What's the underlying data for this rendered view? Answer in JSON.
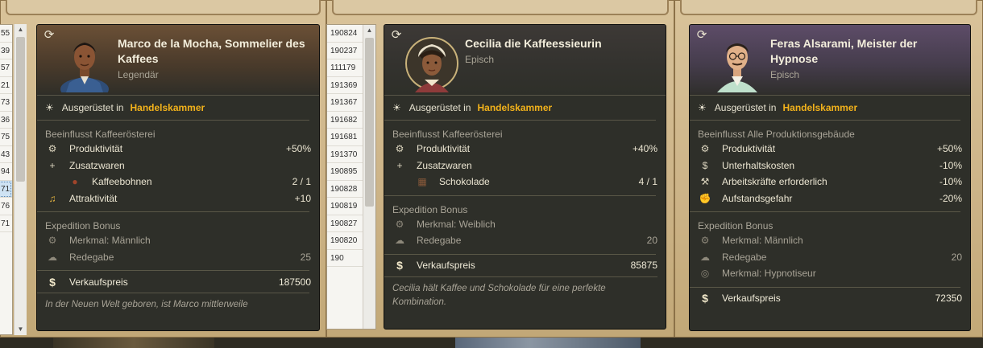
{
  "colors": {
    "accent": "#f2b21b",
    "card_bg": "#2e2f29",
    "list_bg": "#f6f5f1"
  },
  "left_list": {
    "ids": [
      "55",
      "39",
      "57",
      "21",
      "73",
      "36",
      "75",
      "43",
      "94",
      "71",
      "76",
      "71"
    ],
    "selected_index": 9
  },
  "middle_list": {
    "ids": [
      "190824",
      "190237",
      "111179",
      "191369",
      "191367",
      "191682",
      "191681",
      "191370",
      "190895",
      "190828",
      "190819",
      "190827",
      "190820",
      "190"
    ]
  },
  "cards": [
    {
      "portrait_icon": "portrait-marco",
      "title": "Marco de la Mocha, Sommelier des Kaffees",
      "rarity": "Legendär",
      "equip_label": "Ausgerüstet in",
      "equip_value": "Handelskammer",
      "influence_header": "Beeinflusst Kaffeerösterei",
      "stats": [
        {
          "icon": "gear-icon",
          "label": "Produktivität",
          "value": "+50%",
          "sub": false
        },
        {
          "icon": "plus-icon",
          "label": "Zusatzwaren",
          "value": "",
          "sub": false
        },
        {
          "icon": "coffee-beans-icon",
          "label": "Kaffeebohnen",
          "value": "2 / 1",
          "sub": true
        },
        {
          "icon": "lyre-icon",
          "label": "Attraktivität",
          "value": "+10",
          "sub": false
        }
      ],
      "expedition_header": "Expedition Bonus",
      "expedition": [
        {
          "icon": "trait-icon",
          "label": "Merkmal:  Männlich",
          "value": ""
        },
        {
          "icon": "speech-icon",
          "label": "Redegabe",
          "value": "25"
        }
      ],
      "price_label": "Verkaufspreis",
      "price_value": "187500",
      "flavor": "In der Neuen Welt geboren, ist Marco mittlerweile"
    },
    {
      "portrait_icon": "portrait-cecilia",
      "title": "Cecilia die Kaffeessieurin",
      "rarity": "Episch",
      "equip_label": "Ausgerüstet in",
      "equip_value": "Handelskammer",
      "influence_header": "Beeinflusst Kaffeerösterei",
      "stats": [
        {
          "icon": "gear-icon",
          "label": "Produktivität",
          "value": "+40%",
          "sub": false
        },
        {
          "icon": "plus-icon",
          "label": "Zusatzwaren",
          "value": "",
          "sub": false
        },
        {
          "icon": "chocolate-icon",
          "label": "Schokolade",
          "value": "4 / 1",
          "sub": true
        }
      ],
      "expedition_header": "Expedition Bonus",
      "expedition": [
        {
          "icon": "trait-icon",
          "label": "Merkmal:  Weiblich",
          "value": ""
        },
        {
          "icon": "speech-icon",
          "label": "Redegabe",
          "value": "20"
        }
      ],
      "price_label": "Verkaufspreis",
      "price_value": "85875",
      "flavor": "Cecilia hält Kaffee und Schokolade für eine perfekte Kombination."
    },
    {
      "portrait_icon": "portrait-feras",
      "title": "Feras Alsarami, Meister der Hypnose",
      "rarity": "Episch",
      "equip_label": "Ausgerüstet in",
      "equip_value": "Handelskammer",
      "influence_header": "Beeinflusst Alle Produktionsgebäude",
      "stats": [
        {
          "icon": "gear-icon",
          "label": "Produktivität",
          "value": "+50%",
          "sub": false
        },
        {
          "icon": "money-icon",
          "label": "Unterhaltskosten",
          "value": "-10%",
          "sub": false
        },
        {
          "icon": "tools-icon",
          "label": "Arbeitskräfte erforderlich",
          "value": "-10%",
          "sub": false
        },
        {
          "icon": "fist-icon",
          "label": "Aufstandsgefahr",
          "value": "-20%",
          "sub": false
        }
      ],
      "expedition_header": "Expedition Bonus",
      "expedition": [
        {
          "icon": "trait-icon",
          "label": "Merkmal:  Männlich",
          "value": ""
        },
        {
          "icon": "speech-icon",
          "label": "Redegabe",
          "value": "20"
        },
        {
          "icon": "spiral-icon",
          "label": "Merkmal:  Hypnotiseur",
          "value": ""
        }
      ],
      "price_label": "Verkaufspreis",
      "price_value": "72350",
      "flavor": ""
    }
  ]
}
